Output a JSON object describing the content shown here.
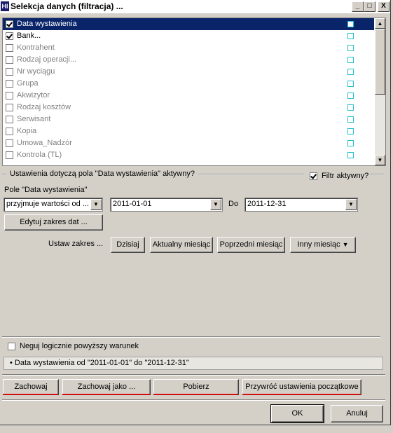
{
  "window": {
    "title": "Selekcja danych (filtracja) ...",
    "app_icon": "HI",
    "controls": [
      "_",
      "□",
      "X"
    ]
  },
  "fields": [
    {
      "label": "Data wystawienia",
      "checked": true,
      "selected": true
    },
    {
      "label": "Bank...",
      "checked": true,
      "selected": false
    },
    {
      "label": "Kontrahent",
      "checked": false,
      "selected": false
    },
    {
      "label": "Rodzaj operacji...",
      "checked": false,
      "selected": false
    },
    {
      "label": "Nr wyciągu",
      "checked": false,
      "selected": false
    },
    {
      "label": "Grupa",
      "checked": false,
      "selected": false
    },
    {
      "label": "Akwizytor",
      "checked": false,
      "selected": false
    },
    {
      "label": "Rodzaj kosztów",
      "checked": false,
      "selected": false
    },
    {
      "label": "Serwisant",
      "checked": false,
      "selected": false
    },
    {
      "label": "Kopia",
      "checked": false,
      "selected": false
    },
    {
      "label": "Umowa_Nadzór",
      "checked": false,
      "selected": false
    },
    {
      "label": "Kontrola (TL)",
      "checked": false,
      "selected": false
    }
  ],
  "settings": {
    "group_title": "Ustawienia dotyczą pola \"Data wystawienia\" aktywny?",
    "filter_active_label": "Filtr aktywny?",
    "filter_active": true,
    "field_caption": "Pole \"Data wystawienia\"",
    "mode_value": "przyjmuje wartości od ...",
    "date_from": "2011-01-01",
    "to_label": "Do",
    "date_to": "2011-12-31",
    "edit_range_label": "Edytuj zakres dat ...",
    "set_range_label": "Ustaw zakres ...",
    "today_label": "Dzisiaj",
    "current_month_label": "Aktualny miesiąc",
    "previous_month_label": "Poprzedni miesiąc",
    "other_month_label": "Inny miesiąc"
  },
  "negate": {
    "label": "Neguj logicznie powyższy warunek",
    "checked": false
  },
  "summary": "• Data wystawienia od \"2011-01-01\" do \"2011-12-31\"",
  "actions": {
    "save": "Zachowaj",
    "save_as": "Zachowaj jako ...",
    "load": "Pobierz",
    "restore": "Przywróć ustawienia początkowe"
  },
  "dialog": {
    "ok": "OK",
    "cancel": "Anuluj"
  },
  "colors": {
    "selection": "#0a246a",
    "accent_underline": "#d01010",
    "marker": "#21c0d0"
  }
}
